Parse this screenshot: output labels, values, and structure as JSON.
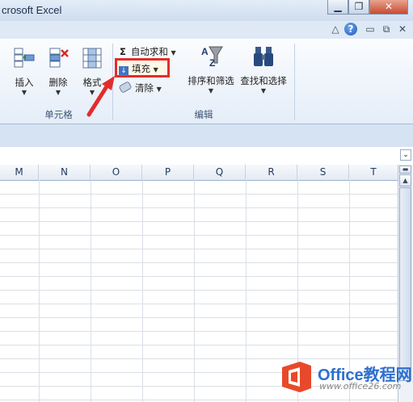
{
  "window": {
    "title": "crosoft Excel",
    "minimize": "▁",
    "restore": "❐",
    "close": "✕"
  },
  "helpbar": {
    "collapse": "△",
    "help": "?",
    "min": "▭",
    "restore": "⧉",
    "close": "✕"
  },
  "ribbon": {
    "cells_group": {
      "label": "单元格",
      "buttons": [
        {
          "label": "插入",
          "icon": "insert-cells-icon"
        },
        {
          "label": "删除",
          "icon": "delete-cells-icon"
        },
        {
          "label": "格式",
          "icon": "format-cells-icon"
        }
      ]
    },
    "edit_group": {
      "label": "编辑",
      "autosum": {
        "symbol": "Σ",
        "label": "自动求和"
      },
      "fill": {
        "label": "填充"
      },
      "clear": {
        "label": "清除"
      },
      "sort_filter": {
        "label": "排序和筛选"
      },
      "find_select": {
        "label": "查找和选择"
      }
    },
    "highlight_color": "#e32c2c"
  },
  "columns": [
    "M",
    "N",
    "O",
    "P",
    "Q",
    "R",
    "S",
    "T"
  ],
  "scrollbar": {
    "up": "▲",
    "split": "▬"
  },
  "watermark": {
    "text": "Office教程网",
    "url": "www.office26.com"
  }
}
